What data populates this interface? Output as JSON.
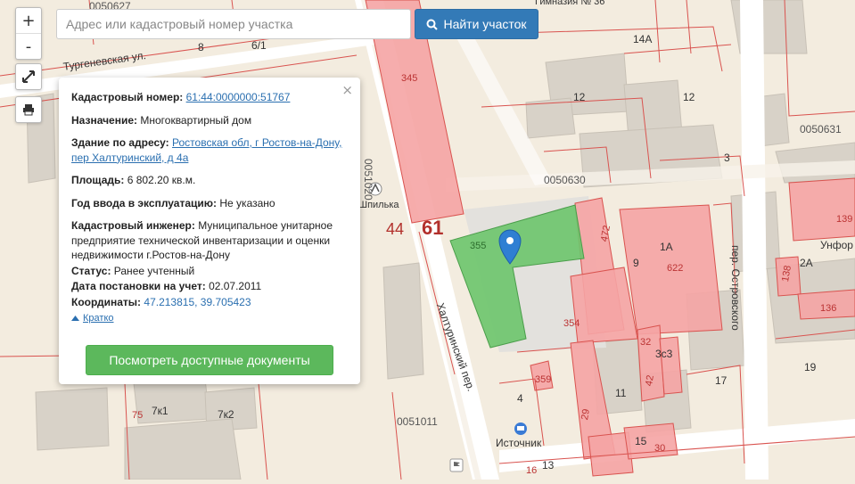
{
  "search": {
    "placeholder": "Адрес или кадастровый номер участка",
    "button_label": "Найти участок"
  },
  "controls": {
    "zoom_in": "+",
    "zoom_out": "-"
  },
  "popup": {
    "cadastral_label": "Кадастровый номер:",
    "cadastral_value": "61:44:0000000:51767",
    "purpose_label": "Назначение:",
    "purpose_value": "Многоквартирный дом",
    "address_label": "Здание по адресу:",
    "address_value": "Ростовская обл, г Ростов-на-Дону, пер Халтуринский, д 4а",
    "area_label": "Площадь:",
    "area_value": "6 802.20 кв.м.",
    "year_label": "Год ввода в эксплуатацию:",
    "year_value": "Не указано",
    "engineer_label": "Кадастровый инженер:",
    "engineer_value": "Муниципальное унитарное предприятие технической инвентаризации и оценки недвижимости г.Ростов-на-Дону",
    "status_label": "Статус:",
    "status_value": "Ранее учтенный",
    "date_label": "Дата постановки на учет:",
    "date_value": "02.07.2011",
    "coords_label": "Координаты:",
    "coords_value": "47.213815, 39.705423",
    "toggle_label": "Кратко",
    "docs_button": "Посмотреть доступные документы",
    "close": "×"
  },
  "map_labels": {
    "street_turgenev": "Тургеневская ул.",
    "street_khalturin": "Халтуринский пер.",
    "street_ostrovsky": "пер. Островского",
    "poi_shpilka": "Шпилька",
    "poi_istochnik": "Источник",
    "poi_gymnasium": "Гимназия № 36",
    "poi_unf": "Унфор",
    "cad_0050630": "0050630",
    "cad_0050631": "0050631",
    "cad_0051011": "0051011",
    "cad_0051020": "0051020",
    "cad_0050627": "0050627",
    "n61": "61",
    "n44": "44",
    "n345": "345",
    "n355": "355",
    "n12": "12",
    "n14A": "14А",
    "n3": "3",
    "n12b": "12",
    "n1A": "1А",
    "n622": "622",
    "n9": "9",
    "n472": "472",
    "n354": "354",
    "n32": "32",
    "n3c3": "3с3",
    "n359": "359",
    "n11": "11",
    "n17": "17",
    "n19": "19",
    "n138": "138",
    "n136": "136",
    "n139": "139",
    "n2A": "2А",
    "n7k1": "7к1",
    "n7k2": "7к2",
    "n75": "75",
    "n15": "15",
    "n30": "30",
    "n29": "29",
    "n13": "13",
    "n16": "16",
    "n6_1": "6/1",
    "n42": "42",
    "n4": "4",
    "n8": "8"
  },
  "colors": {
    "parcel_red": "#f5a4a4",
    "parcel_red_stroke": "#d9534f",
    "selected_green": "#6cc56c",
    "road": "#ffffff",
    "building": "#d9d4cc",
    "search_blue": "#337ab7",
    "docs_green": "#5cb85c"
  }
}
